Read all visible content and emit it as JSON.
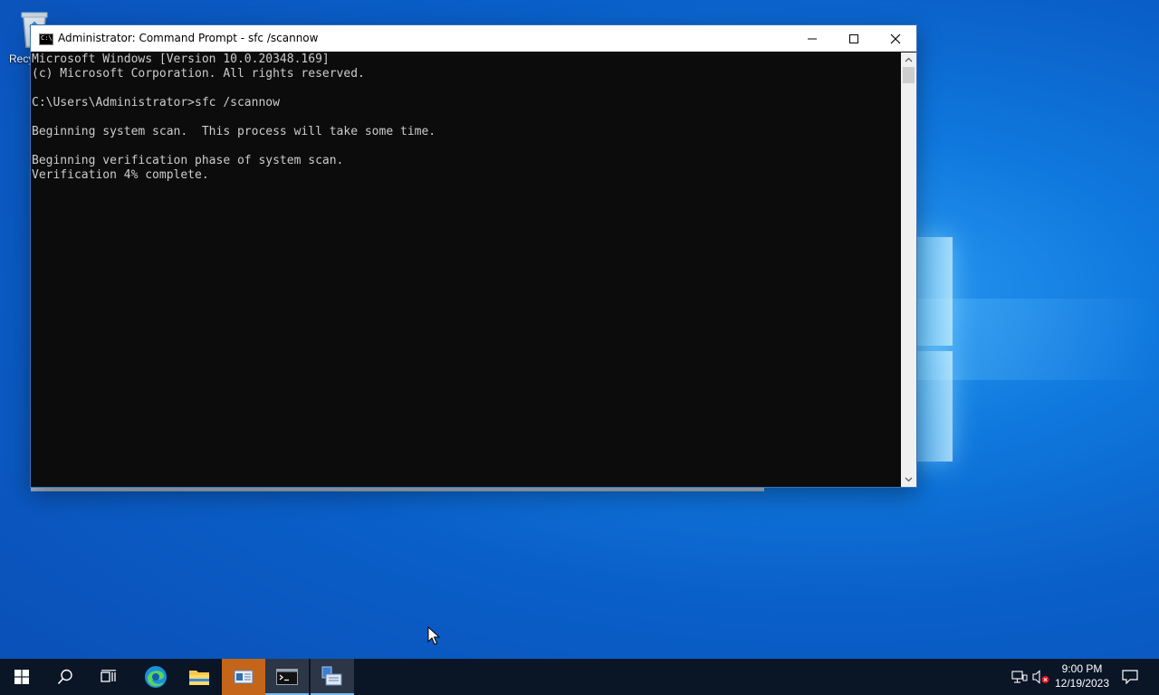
{
  "desktop": {
    "recycle_bin_label": "Recy"
  },
  "window": {
    "title": "Administrator: Command Prompt - sfc  /scannow",
    "console_lines": [
      "Microsoft Windows [Version 10.0.20348.169]",
      "(c) Microsoft Corporation. All rights reserved.",
      "",
      "C:\\Users\\Administrator>sfc /scannow",
      "",
      "Beginning system scan.  This process will take some time.",
      "",
      "Beginning verification phase of system scan.",
      "Verification 4% complete."
    ],
    "buttons": {
      "minimize": "minimize-icon",
      "maximize": "maximize-icon",
      "close": "close-icon"
    }
  },
  "taskbar": {
    "items": [
      {
        "name": "start-button",
        "icon": "windows-start-icon"
      },
      {
        "name": "search-button",
        "icon": "search-icon"
      },
      {
        "name": "task-view-button",
        "icon": "task-view-icon"
      },
      {
        "name": "edge-button",
        "icon": "edge-icon"
      },
      {
        "name": "file-explorer-button",
        "icon": "folder-icon"
      },
      {
        "name": "server-manager-button",
        "icon": "server-manager-icon"
      },
      {
        "name": "command-prompt-button",
        "icon": "cmd-icon"
      },
      {
        "name": "remote-desktop-button",
        "icon": "network-app-icon"
      }
    ],
    "clock": {
      "time": "9:00 PM",
      "date": "12/19/2023"
    },
    "tray": [
      "network-icon",
      "volume-muted-icon",
      "notifications-icon"
    ]
  },
  "colors": {
    "console_bg": "#0c0c0c",
    "console_text": "#cccccc",
    "taskbar_bg": "#0a1526",
    "accent": "#0a5fc8"
  }
}
